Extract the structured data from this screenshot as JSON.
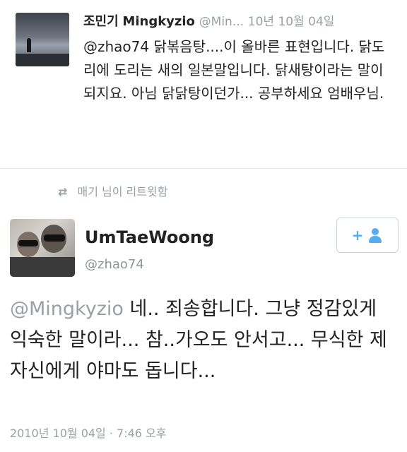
{
  "reply": {
    "name": "조민기",
    "screen_name": "Mingkyzio",
    "handle": "@Min...",
    "time": "10년 10월 04일",
    "text": "@zhao74 닭볶음탕....이 올바른 표현입니다. 닭도리에 도리는 새의 일본말입니다. 닭새탕이라는 말이 되지요. 아님 닭닭탕이던가... 공부하세요 엄배우님."
  },
  "retweet": {
    "icon": "retweet-icon",
    "text": "매기 님이 리트윗함"
  },
  "tweet": {
    "name": "UmTaeWoong",
    "handle": "@zhao74",
    "follow_icon": "follow-plus-person-icon",
    "follow_plus": "+",
    "mention": "@Mingkyzio",
    "text": " 네.. 죄송합니다.  그냥 정감있게 익숙한 말이라... 참..가오도 안서고... 무식한 제자신에게 야마도 돕니다...",
    "timestamp": "2010년 10월 04일 · 7:46 오후"
  },
  "colors": {
    "accent": "#55acee",
    "muted": "#9aa0a6",
    "text": "#222222"
  }
}
